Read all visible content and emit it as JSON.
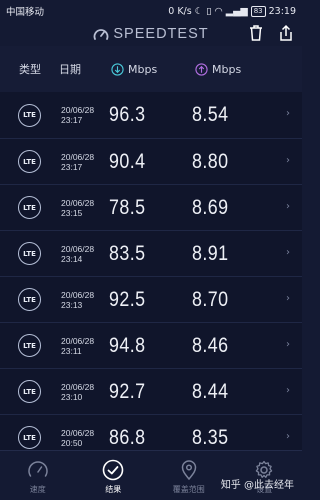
{
  "status_bar": {
    "carrier": "中国移动",
    "net_speed": "0 K/s",
    "battery": "83",
    "time": "23:19"
  },
  "header": {
    "title": "SPEEDTEST",
    "icons": [
      "speedtest-logo-icon",
      "trash-icon",
      "share-icon"
    ]
  },
  "columns": {
    "type": "类型",
    "date": "日期",
    "download": "Mbps",
    "upload": "Mbps",
    "download_icon_color": "#49c8d8",
    "upload_icon_color": "#b06ee0"
  },
  "results": [
    {
      "type": "LTE",
      "date": "20/06/28",
      "time": "23:17",
      "download": "96.3",
      "upload": "8.54"
    },
    {
      "type": "LTE",
      "date": "20/06/28",
      "time": "23:17",
      "download": "90.4",
      "upload": "8.80"
    },
    {
      "type": "LTE",
      "date": "20/06/28",
      "time": "23:15",
      "download": "78.5",
      "upload": "8.69"
    },
    {
      "type": "LTE",
      "date": "20/06/28",
      "time": "23:14",
      "download": "83.5",
      "upload": "8.91"
    },
    {
      "type": "LTE",
      "date": "20/06/28",
      "time": "23:13",
      "download": "92.5",
      "upload": "8.70"
    },
    {
      "type": "LTE",
      "date": "20/06/28",
      "time": "23:11",
      "download": "94.8",
      "upload": "8.46"
    },
    {
      "type": "LTE",
      "date": "20/06/28",
      "time": "23:10",
      "download": "92.7",
      "upload": "8.44"
    },
    {
      "type": "LTE",
      "date": "20/06/28",
      "time": "20:50",
      "download": "86.8",
      "upload": "8.35"
    }
  ],
  "bottom_nav": {
    "items": [
      {
        "label": "速度",
        "icon": "speedometer-icon",
        "active": false
      },
      {
        "label": "结果",
        "icon": "check-circle-icon",
        "active": true
      },
      {
        "label": "覆盖范围",
        "icon": "location-pin-icon",
        "active": false
      },
      {
        "label": "设置",
        "icon": "gear-icon",
        "active": false
      }
    ]
  },
  "watermark": "知乎 @此去经年"
}
